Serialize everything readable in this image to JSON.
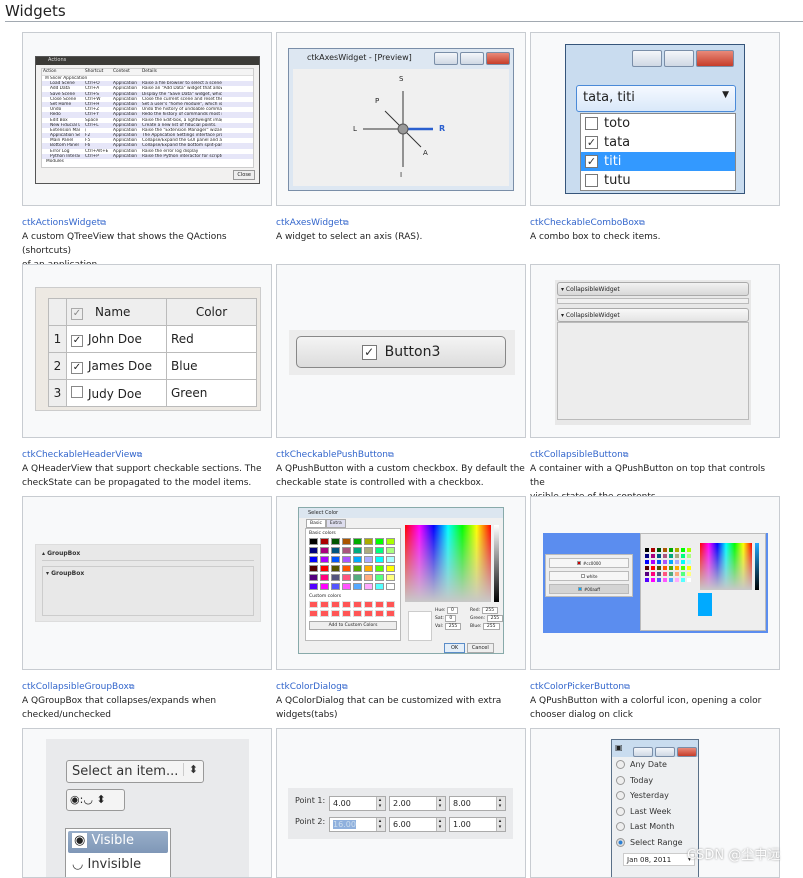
{
  "section_title": "Widgets",
  "widgets": [
    {
      "name": "ctkActionsWidget",
      "desc": [
        "A custom QTreeView that shows the QActions (shortcuts)",
        "of an application."
      ]
    },
    {
      "name": "ctkAxesWidget",
      "desc": [
        "A widget to select an axis (RAS)."
      ]
    },
    {
      "name": "ctkCheckableComboBox",
      "desc": [
        "A combo box to check items."
      ]
    },
    {
      "name": "ctkCheckableHeaderView",
      "desc": [
        "A QHeaderView that support checkable sections. The",
        "checkState can be propagated to the model items."
      ]
    },
    {
      "name": "ctkCheckablePushButton",
      "desc": [
        "A QPushButton with a custom checkbox. By default the",
        "checkable state is controlled with a checkbox."
      ]
    },
    {
      "name": "ctkCollapsibleButton",
      "desc": [
        "A container with a QPushButton on top that controls the",
        "visible state of the contents"
      ]
    },
    {
      "name": "ctkCollapsibleGroupBox",
      "desc": [
        "A QGroupBox that collapses/expands when",
        "checked/unchecked"
      ]
    },
    {
      "name": "ctkColorDialog",
      "desc": [
        "A QColorDialog that can be customized with extra",
        "widgets(tabs)"
      ]
    },
    {
      "name": "ctkColorPickerButton",
      "desc": [
        "A QPushButton with a colorful icon, opening a color",
        "chooser dialog on click"
      ]
    }
  ],
  "actions": {
    "title": "Actions",
    "headers": [
      "Action",
      "Shortcut",
      "Context",
      "Details"
    ],
    "root": "Slicer Application",
    "rows": [
      [
        "Load Scene",
        "Ctrl+O",
        "Application",
        "Raise a file browser to select a scene (mrml, xc..."
      ],
      [
        "Add Data",
        "Ctrl+A",
        "Application",
        "Raise an \"Add Data\" widget that allows you to s..."
      ],
      [
        "Save Scene",
        "Ctrl+S",
        "Application",
        "Display the \"Save Data\" widget, which offers m..."
      ],
      [
        "Close Scene",
        "Ctrl+W",
        "Application",
        "Close the current scene and reset the applicatio..."
      ],
      [
        "Set Home",
        "Ctrl+H",
        "Application",
        "Set a user's \"home module\", which is the modul..."
      ],
      [
        "Undo",
        "Ctrl+Z",
        "Application",
        "Undo the history of undoable commands, from l..."
      ],
      [
        "Redo",
        "Ctrl+Y",
        "Application",
        "Redo the history of commands most recently un..."
      ],
      [
        "Edit Box",
        "Space",
        "Application",
        "Raise the Edit-box, a lightweight image editing t..."
      ],
      [
        "New Fiducial List",
        "Ctrl+L",
        "Application",
        "Create a new list of fiducial points."
      ],
      [
        "Extension Manager",
        "/",
        "Application",
        "Raise the \"Extension Manager\" wizard that prov..."
      ],
      [
        "Application Settings",
        "F2",
        "Application",
        "The Application Settings interface provides opti..."
      ],
      [
        "Main Panel",
        "F5",
        "Application",
        "Collapse/Expand the GUI panel and allows Slicer..."
      ],
      [
        "Bottom Panel",
        "F6",
        "Application",
        "Collapse/Expand the bottom split-panel in which..."
      ],
      [
        "Error Log",
        "Ctrl+Alt+E",
        "Application",
        "Raise the error log display"
      ],
      [
        "Python Interactor",
        "Ctrl+P",
        "Application",
        "Raise the Python interactor for scripted interacti..."
      ]
    ],
    "modules": "Modules",
    "close": "Close"
  },
  "axes": {
    "title": "ctkAxesWidget - [Preview]",
    "labels": {
      "S": "S",
      "I": "I",
      "L": "L",
      "R": "R",
      "P": "P",
      "A": "A"
    }
  },
  "combo": {
    "value": "tata, titi",
    "items": [
      {
        "label": "toto",
        "checked": false
      },
      {
        "label": "tata",
        "checked": true
      },
      {
        "label": "titi",
        "checked": true,
        "selected": true
      },
      {
        "label": "tutu",
        "checked": false
      }
    ]
  },
  "header_view": {
    "headers": [
      "Name",
      "Color"
    ],
    "rows": [
      {
        "n": "1",
        "name": "John Doe",
        "color": "Red",
        "checked": true
      },
      {
        "n": "2",
        "name": "James Doe",
        "color": "Blue",
        "checked": true
      },
      {
        "n": "3",
        "name": "Judy Doe",
        "color": "Green",
        "checked": false
      }
    ]
  },
  "push_button": {
    "label": "Button3",
    "checked": true
  },
  "collapsible_button": {
    "labels": [
      "CollapsibleWidget",
      "CollapsibleWidget"
    ]
  },
  "group_box": {
    "labels": [
      "GroupBox",
      "GroupBox"
    ]
  },
  "color_dialog": {
    "title": "Select Color",
    "tabs": [
      "Basic",
      "Extra"
    ],
    "basic_label": "Basic colors",
    "custom_label": "Custom colors",
    "add_button": "Add to Custom Colors",
    "fields": [
      [
        "Hue:",
        "0"
      ],
      [
        "Sat:",
        "0"
      ],
      [
        "Val:",
        "255"
      ],
      [
        "Red:",
        "255"
      ],
      [
        "Green:",
        "255"
      ],
      [
        "Blue:",
        "255"
      ]
    ],
    "ok": "OK",
    "cancel": "Cancel",
    "basic_colors": [
      "#000000",
      "#aa0000",
      "#005500",
      "#aa5500",
      "#00aa00",
      "#aaaa00",
      "#00ff00",
      "#aaff00",
      "#00007f",
      "#aa007f",
      "#00557f",
      "#aa557f",
      "#00aa7f",
      "#aaaa7f",
      "#00ff7f",
      "#aaff7f",
      "#0000ff",
      "#aa00ff",
      "#0055ff",
      "#aa55ff",
      "#00aaff",
      "#aaaaff",
      "#00ffff",
      "#aaffff",
      "#550000",
      "#ff0000",
      "#555500",
      "#ff5500",
      "#55aa00",
      "#ffaa00",
      "#55ff00",
      "#ffff00",
      "#55007f",
      "#ff007f",
      "#55557f",
      "#ff557f",
      "#55aa7f",
      "#ffaa7f",
      "#55ff7f",
      "#ffff7f",
      "#5500ff",
      "#ff00ff",
      "#5555ff",
      "#ff55ff",
      "#55aaff",
      "#ffaaff",
      "#55ffff",
      "#ffffff"
    ],
    "custom_color": "#ff5555"
  },
  "color_picker": {
    "buttons": [
      {
        "label": "#cc0000",
        "color": "#cc0000"
      },
      {
        "label": "white",
        "color": "#ffffff"
      },
      {
        "label": "#00aaff",
        "color": "#00aaff"
      }
    ],
    "accent": "#5b8def"
  },
  "combo_visibility": {
    "placeholder": "Select an item...",
    "items": [
      "Visible",
      "Invisible"
    ]
  },
  "coordinates": {
    "rows": [
      {
        "label": "Point 1:",
        "values": [
          "4.00",
          "2.00",
          "8.00"
        ]
      },
      {
        "label": "Point 2:",
        "values": [
          "16.00",
          "6.00",
          "1.00"
        ]
      }
    ]
  },
  "date_range": {
    "options": [
      "Any Date",
      "Today",
      "Yesterday",
      "Last Week",
      "Last Month",
      "Select Range"
    ],
    "selected": "Select Range",
    "date": "Jan 08, 2011"
  },
  "watermark": "CSDN @尘中远"
}
